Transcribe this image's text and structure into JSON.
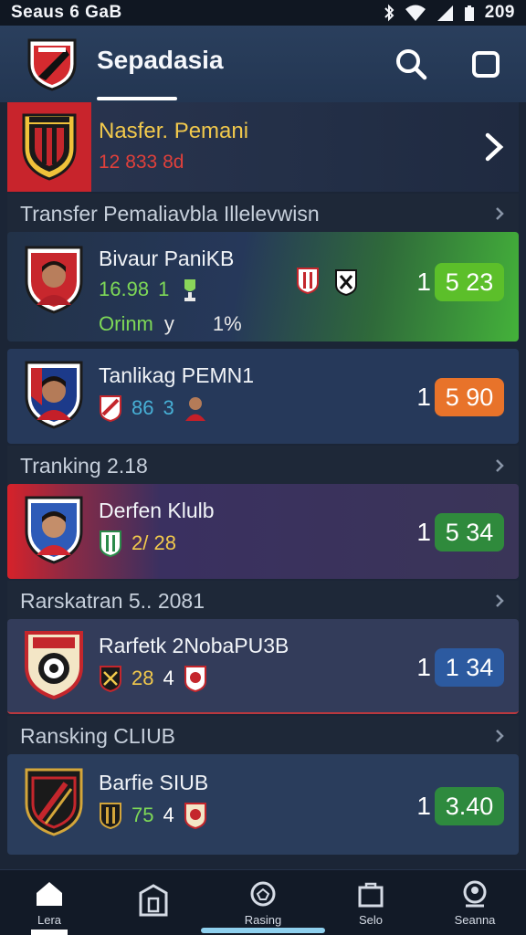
{
  "status_bar": {
    "left_text": "Seaus 6 GaB",
    "time": "209"
  },
  "header": {
    "title": "Sepadasia",
    "search_icon": "search-icon",
    "square_icon": "square-icon"
  },
  "hero": {
    "title": "Nasfer. Pemani",
    "subtitle": "12 833 8d"
  },
  "sections": [
    {
      "label": "Transfer Pemaliavbla Illelevwisn"
    },
    {
      "label": "Tranking 2.18"
    },
    {
      "label": "Rarskatran 5.. 2081"
    },
    {
      "label": "Ransking CLIUB"
    }
  ],
  "cards": [
    {
      "name": "Bivaur PaniKB",
      "stat1": "16.98",
      "stat2": "1",
      "footer_left": "Orinm",
      "footer_mid": "y",
      "footer_right": "1%",
      "rank": "1",
      "score": "5 23",
      "score_color": "#5cbf2a"
    },
    {
      "name": "Tanlikag PEMN1",
      "stat1": "86",
      "stat2": "3",
      "rank": "1",
      "score": "5 90",
      "score_color": "#e8732a"
    },
    {
      "name": "Derfen Klulb",
      "stat1": "2/ 28",
      "rank": "1",
      "score": "5 34",
      "score_color": "#2f8a3c"
    },
    {
      "name": "Rarfetk 2NobaPU3B",
      "stat1": "28",
      "stat2": "4",
      "rank": "1",
      "score": "1 34",
      "score_color": "#2c5aa0"
    },
    {
      "name": "Barfie SIUB",
      "stat1": "75",
      "stat2": "4",
      "rank": "1",
      "score": "3.40",
      "score_color": "#2e8a3e"
    }
  ],
  "bottom_nav": [
    {
      "label": "Lera",
      "icon": "home-icon"
    },
    {
      "label": "",
      "icon": "building-icon"
    },
    {
      "label": "Rasing",
      "icon": "ball-icon"
    },
    {
      "label": "Selo",
      "icon": "bag-icon"
    },
    {
      "label": "Seanna",
      "icon": "profile-icon"
    }
  ]
}
